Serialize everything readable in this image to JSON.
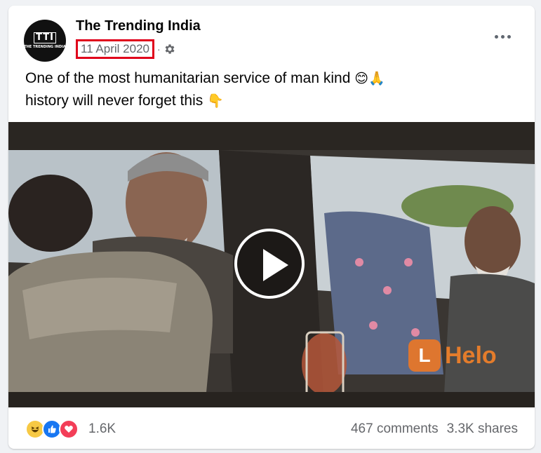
{
  "post": {
    "page_name": "The Trending India",
    "avatar_logo": "TTI",
    "avatar_logo_sub": "THE TRENDING INDIA",
    "date": "11 April 2020",
    "separator": "·",
    "privacy_icon": "gear-icon",
    "text_line1": "One of the most humanitarian service of man kind",
    "text_line1_emoji": "😊🙏",
    "text_line2": "history will never forget this",
    "text_line2_emoji": "👇",
    "more_icon": "more-options-icon"
  },
  "video": {
    "play_icon": "play-icon",
    "watermark_text": "Helo",
    "watermark_icon": "L"
  },
  "footer": {
    "reaction_icons": [
      "haha-icon",
      "like-icon",
      "love-icon"
    ],
    "reaction_count": "1.6K",
    "comments": "467 comments",
    "shares": "3.3K shares"
  },
  "colors": {
    "highlight_box": "#e0001b",
    "secondary_text": "#65676b",
    "like_blue": "#1877f2",
    "love_red": "#f33e58",
    "haha_yellow": "#f7c944"
  }
}
